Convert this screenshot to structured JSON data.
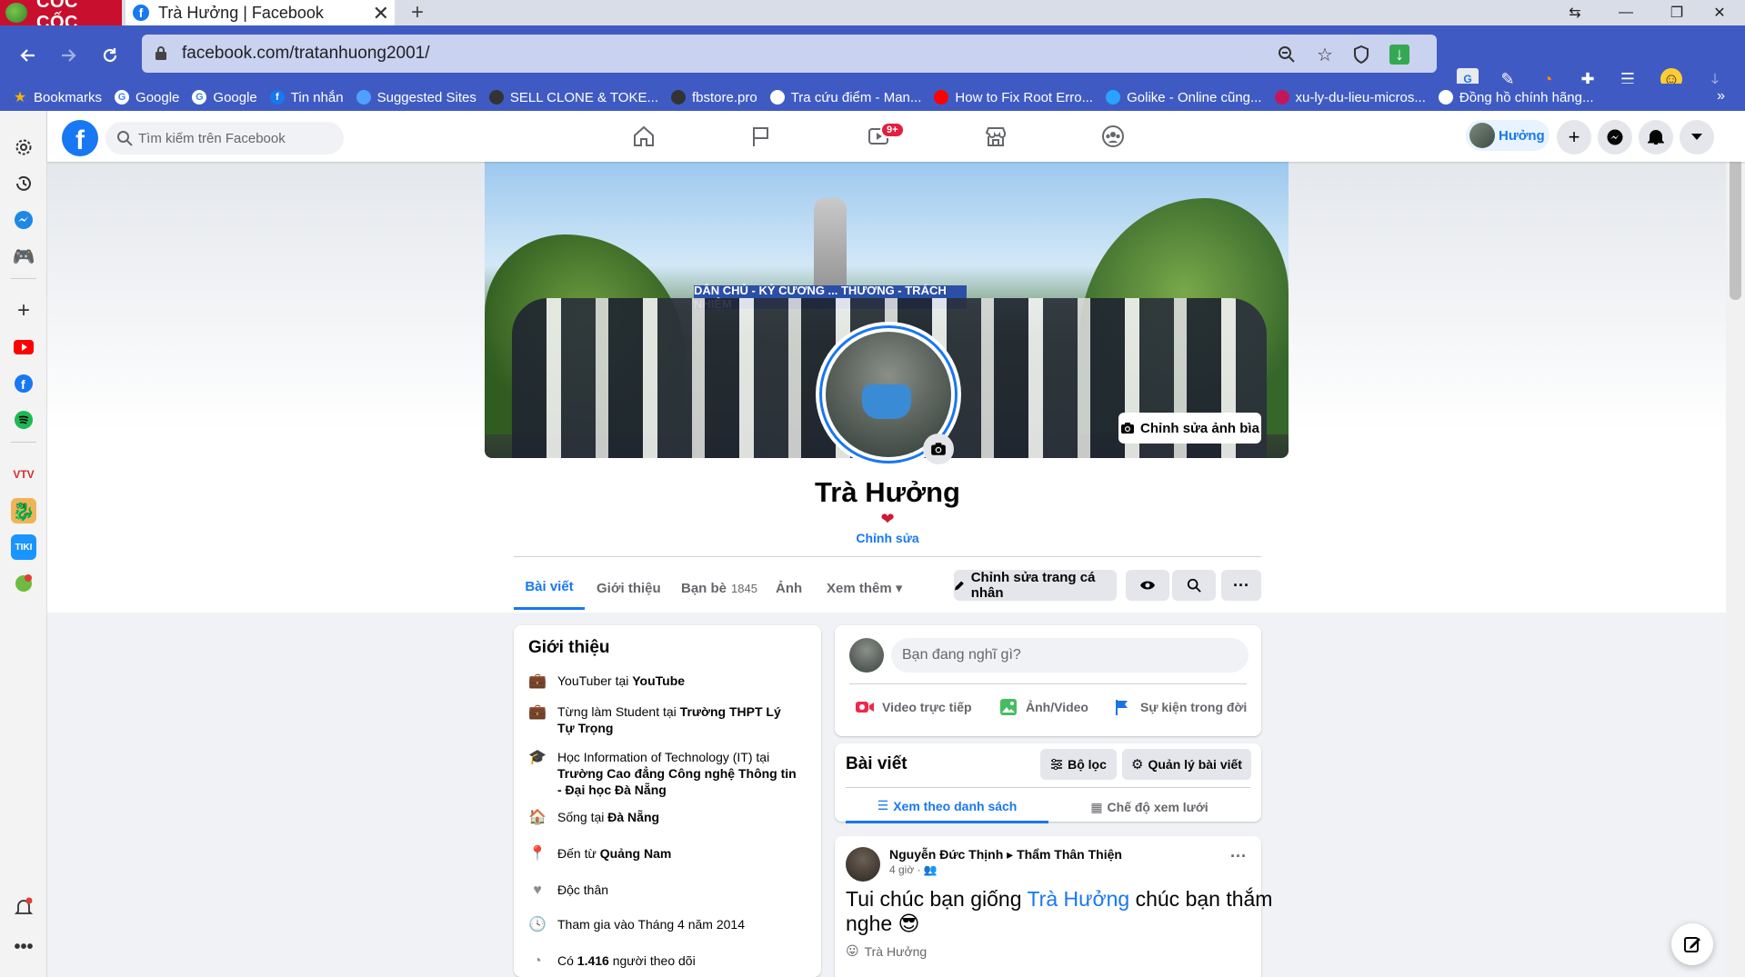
{
  "browser": {
    "brand": "CỐC CỐC",
    "tab_title": "Trà Hưởng | Facebook",
    "tab_close": "✕",
    "new_tab": "+",
    "url": "facebook.com/tratanhuong2001/",
    "window_controls": [
      "⇆",
      "—",
      "❐",
      "✕"
    ],
    "bookmarks": [
      {
        "label": "Bookmarks",
        "icon": "star-icon",
        "color": "#f4b400"
      },
      {
        "label": "Google",
        "icon": "google-icon",
        "color": "#ffffff"
      },
      {
        "label": "Google",
        "icon": "google-icon",
        "color": "#ffffff"
      },
      {
        "label": "Tin nhắn",
        "icon": "facebook-icon",
        "color": "#1877f2"
      },
      {
        "label": "Suggested Sites",
        "icon": "ie-icon",
        "color": "#4ea1ff"
      },
      {
        "label": "SELL CLONE & TOKE...",
        "icon": "globe-icon",
        "color": "#333333"
      },
      {
        "label": "fbstore.pro",
        "icon": "globe-icon",
        "color": "#333333"
      },
      {
        "label": "Tra cứu điểm - Man...",
        "icon": "doc-icon",
        "color": "#ffffff"
      },
      {
        "label": "How to Fix Root Erro...",
        "icon": "youtube-icon",
        "color": "#ff0000"
      },
      {
        "label": "Golike - Online cũng...",
        "icon": "golike-icon",
        "color": "#29a3ff"
      },
      {
        "label": "xu-ly-du-lieu-micros...",
        "icon": "app-icon",
        "color": "#c2185b"
      },
      {
        "label": "Đồng hồ chính hãng...",
        "icon": "shield-plus-icon",
        "color": "#ffffff"
      }
    ],
    "bookmarks_more": "»"
  },
  "facebook": {
    "logo": "f",
    "search_placeholder": "Tìm kiếm trên Facebook",
    "watch_badge": "9+",
    "profile_chip": "Hưởng"
  },
  "profile": {
    "cover_banner": "DÂN CHỦ - KỶ CƯƠNG ... THƯƠNG - TRÁCH NHIỆM",
    "edit_cover": "Chỉnh sửa ảnh bìa",
    "name": "Trà Hưởng",
    "bio_emoji": "❤",
    "edit_bio": "Chỉnh sửa",
    "tabs": [
      {
        "label": "Bài viết",
        "count": ""
      },
      {
        "label": "Giới thiệu",
        "count": ""
      },
      {
        "label": "Bạn bè",
        "count": "1845"
      },
      {
        "label": "Ảnh",
        "count": ""
      },
      {
        "label": "Xem thêm ▾",
        "count": ""
      }
    ],
    "edit_profile": "Chỉnh sửa trang cá nhân"
  },
  "intro": {
    "title": "Giới thiệu",
    "items": [
      {
        "prefix": "YouTuber tại ",
        "bold": "YouTube"
      },
      {
        "prefix": "Từng làm Student tại ",
        "bold": "Trường THPT Lý Tự Trọng"
      },
      {
        "prefix": "Học Information of Technology (IT) tại ",
        "bold": "Trường Cao đẳng Công nghệ Thông tin - Đại học Đà Nẵng"
      },
      {
        "prefix": "Sống tại ",
        "bold": "Đà Nẵng"
      },
      {
        "prefix": "Đến từ ",
        "bold": "Quảng Nam"
      },
      {
        "prefix": "Độc thân",
        "bold": ""
      },
      {
        "prefix": "Tham gia vào Tháng 4 năm 2014",
        "bold": ""
      },
      {
        "prefix": "Có ",
        "bold": "1.416",
        "suffix": " người theo dõi"
      }
    ]
  },
  "composer": {
    "placeholder": "Bạn đang nghĩ gì?",
    "actions": [
      "Video trực tiếp",
      "Ảnh/Video",
      "Sự kiện trong đời"
    ]
  },
  "posts_panel": {
    "title": "Bài viết",
    "filter": "Bộ lọc",
    "manage": "Quản lý bài viết",
    "view_list": "Xem theo danh sách",
    "view_grid": "Chế độ xem lưới"
  },
  "post": {
    "author": "Nguyễn Đức Thịnh",
    "arrow": "▸",
    "target": "Thẩm Thân Thiện",
    "time": "4 giờ · 👥",
    "more": "···",
    "text_before": "Tui chúc bạn giống ",
    "mention": "Trà Hưởng",
    "text_after": " chúc bạn thắm nghe 😎",
    "reaction_emoji": "😛",
    "reaction_name": "Trà Hưởng"
  }
}
